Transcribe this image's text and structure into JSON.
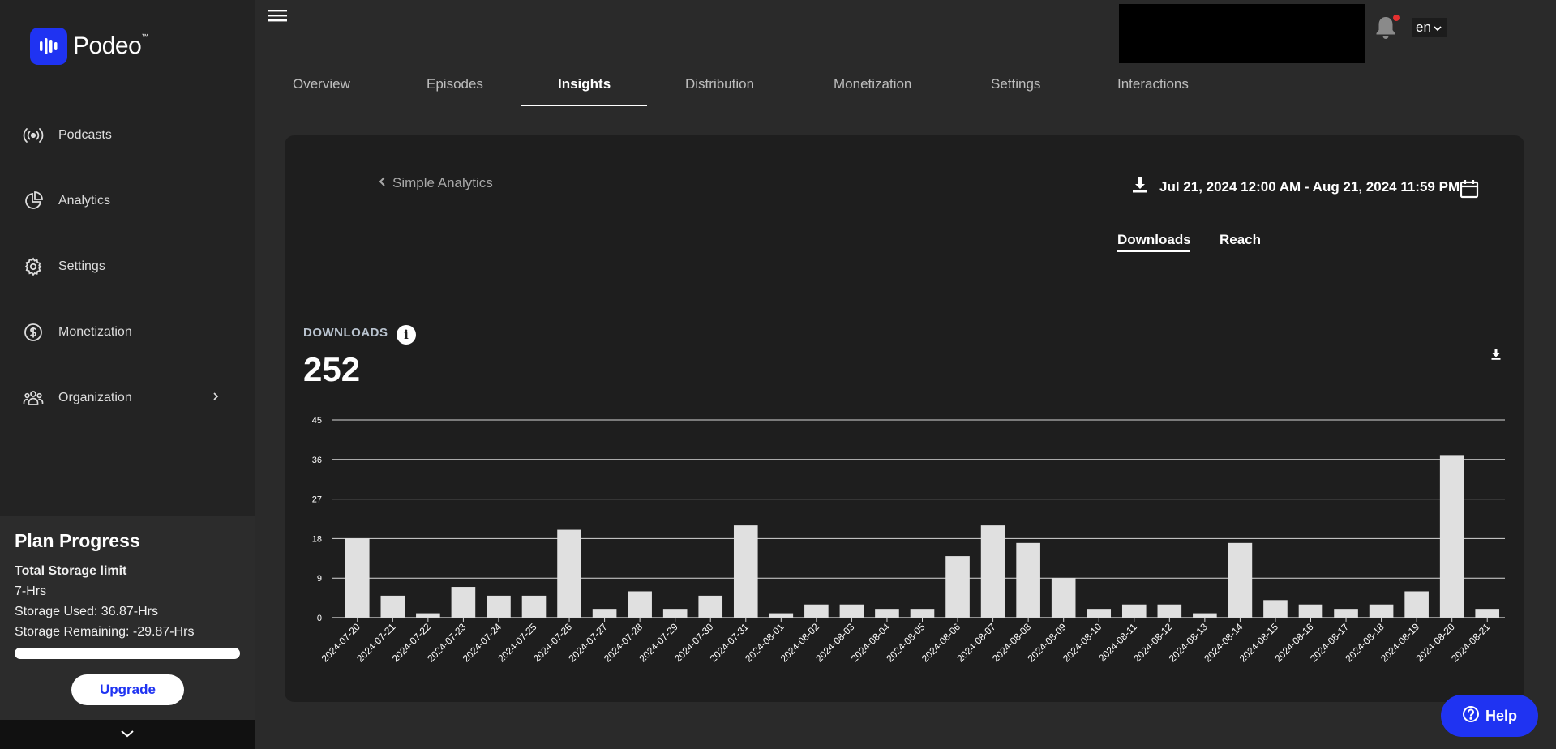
{
  "brand": {
    "name": "Podeo",
    "trademark": "™"
  },
  "sidebar": {
    "items": [
      {
        "label": "Podcasts",
        "icon": "broadcast-icon"
      },
      {
        "label": "Analytics",
        "icon": "pie-chart-icon"
      },
      {
        "label": "Settings",
        "icon": "gear-icon"
      },
      {
        "label": "Monetization",
        "icon": "dollar-icon"
      },
      {
        "label": "Organization",
        "icon": "users-icon"
      }
    ]
  },
  "plan": {
    "title": "Plan Progress",
    "limit_label": "Total Storage limit",
    "limit_value": "7-Hrs",
    "used": "Storage Used: 36.87-Hrs",
    "remaining": "Storage Remaining: -29.87-Hrs",
    "upgrade_label": "Upgrade"
  },
  "topbar": {
    "language": "en"
  },
  "tabs": [
    {
      "label": "Overview"
    },
    {
      "label": "Episodes"
    },
    {
      "label": "Insights"
    },
    {
      "label": "Distribution"
    },
    {
      "label": "Monetization"
    },
    {
      "label": "Settings"
    },
    {
      "label": "Interactions"
    }
  ],
  "insights": {
    "back_label": "Simple Analytics",
    "date_range": "Jul 21, 2024 12:00 AM - Aug 21, 2024 11:59 PM",
    "subtabs": [
      {
        "label": "Downloads"
      },
      {
        "label": "Reach"
      }
    ],
    "metric_label": "DOWNLOADS",
    "metric_value": "252"
  },
  "help_label": "Help",
  "colors": {
    "accent": "#1f33f2",
    "bar": "#e0e0e0",
    "notification": "#e53030"
  },
  "chart_data": {
    "type": "bar",
    "categories": [
      "2024-07-20",
      "2024-07-21",
      "2024-07-22",
      "2024-07-23",
      "2024-07-24",
      "2024-07-25",
      "2024-07-26",
      "2024-07-27",
      "2024-07-28",
      "2024-07-29",
      "2024-07-30",
      "2024-07-31",
      "2024-08-01",
      "2024-08-02",
      "2024-08-03",
      "2024-08-04",
      "2024-08-05",
      "2024-08-06",
      "2024-08-07",
      "2024-08-08",
      "2024-08-09",
      "2024-08-10",
      "2024-08-11",
      "2024-08-12",
      "2024-08-13",
      "2024-08-14",
      "2024-08-15",
      "2024-08-16",
      "2024-08-17",
      "2024-08-18",
      "2024-08-19",
      "2024-08-20",
      "2024-08-21"
    ],
    "values": [
      18,
      5,
      1,
      7,
      5,
      5,
      20,
      2,
      6,
      2,
      5,
      21,
      1,
      3,
      3,
      2,
      2,
      14,
      21,
      17,
      9,
      2,
      3,
      3,
      1,
      17,
      4,
      3,
      2,
      3,
      6,
      37,
      2
    ],
    "yticks": [
      0,
      9,
      18,
      27,
      36,
      45
    ],
    "ylim": [
      0,
      45
    ],
    "grid": true
  }
}
